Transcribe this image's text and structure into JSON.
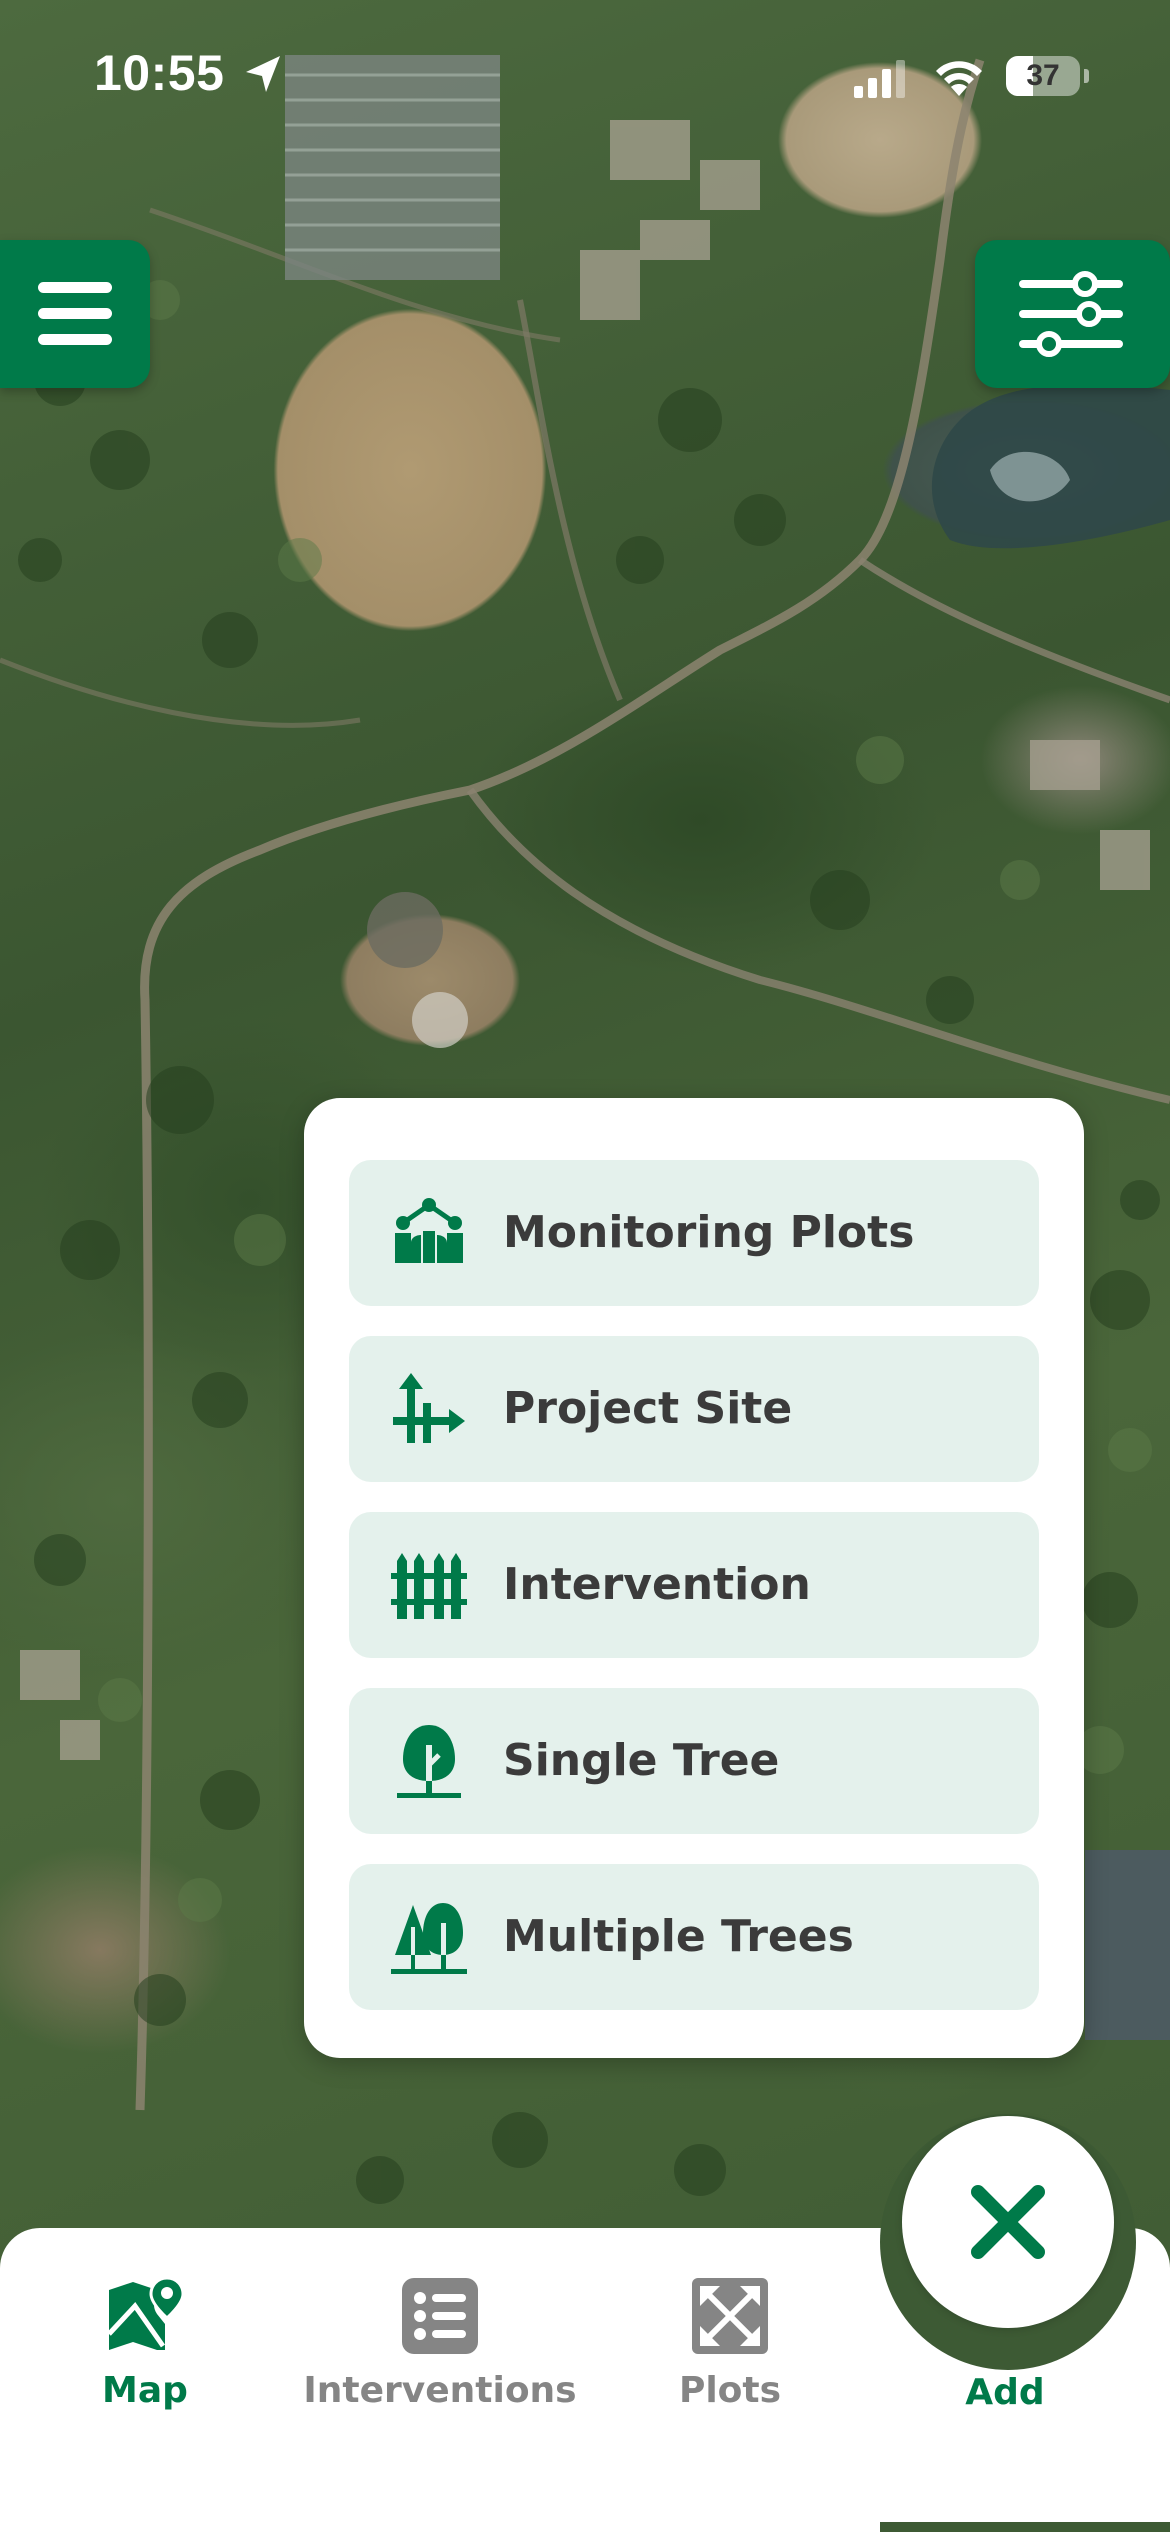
{
  "status_bar": {
    "time": "10:55",
    "battery_level": "37",
    "battery_fraction": 0.37,
    "icons": [
      "location-arrow-icon",
      "cellular-signal-icon",
      "wifi-icon",
      "battery-icon"
    ]
  },
  "map": {
    "menu_icon": "hamburger-menu-icon",
    "filter_icon": "sliders-filter-icon"
  },
  "add_menu": {
    "options": [
      {
        "label": "Monitoring Plots",
        "icon": "monitoring-plots-icon"
      },
      {
        "label": "Project Site",
        "icon": "project-site-icon"
      },
      {
        "label": "Intervention",
        "icon": "fence-intervention-icon"
      },
      {
        "label": "Single Tree",
        "icon": "single-tree-icon"
      },
      {
        "label": "Multiple Trees",
        "icon": "multiple-trees-icon"
      }
    ]
  },
  "bottom_nav": {
    "items": [
      {
        "label": "Map",
        "icon": "map-pin-icon",
        "active": true
      },
      {
        "label": "Interventions",
        "icon": "list-icon",
        "active": false
      },
      {
        "label": "Plots",
        "icon": "expand-arrows-icon",
        "active": false
      },
      {
        "label": "Add",
        "icon": "close-x-icon",
        "active": true
      }
    ]
  },
  "colors": {
    "brand_green": "#007a49",
    "option_bg": "#e4f1ec",
    "inactive_gray": "#858585",
    "label_dark": "#3b3b3b"
  }
}
